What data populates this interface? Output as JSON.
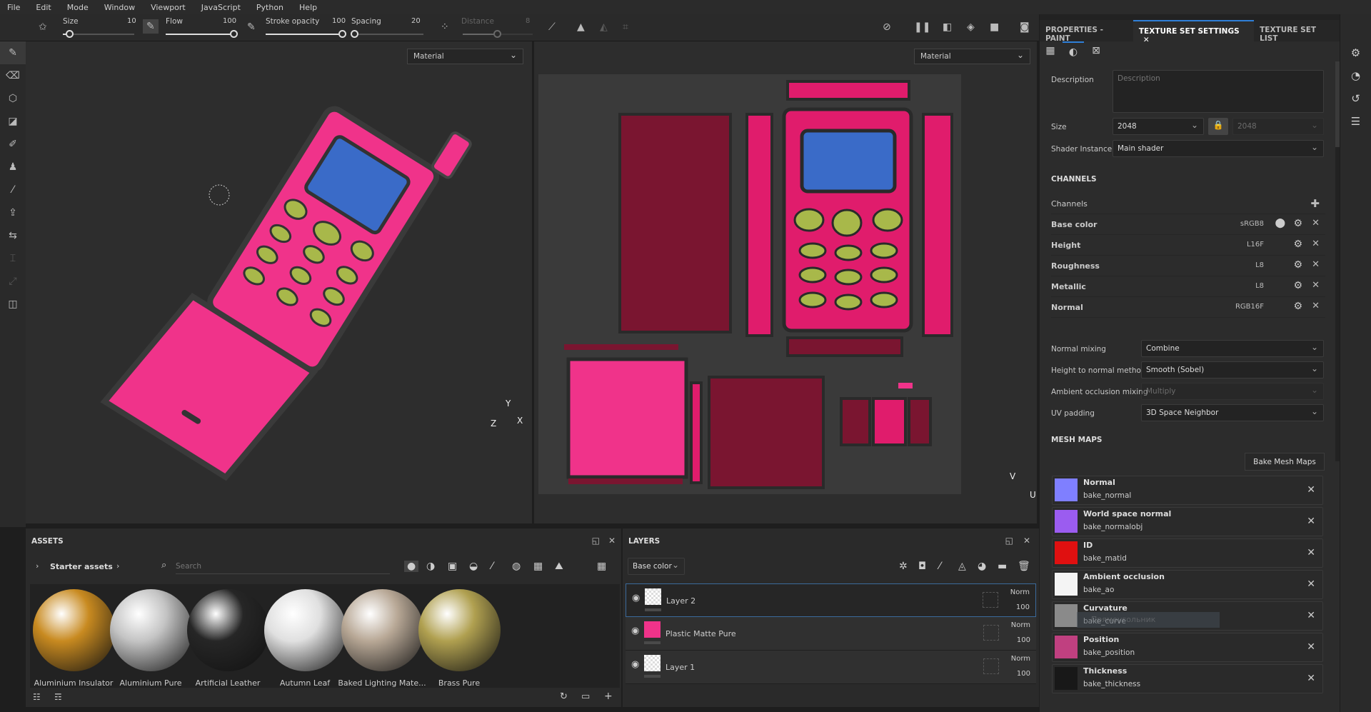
{
  "menu": [
    "File",
    "Edit",
    "Mode",
    "Window",
    "Viewport",
    "JavaScript",
    "Python",
    "Help"
  ],
  "toolbar": {
    "size": {
      "label": "Size",
      "value": "10",
      "fraction": 0.1
    },
    "flow": {
      "label": "Flow",
      "value": "100",
      "fraction": 1.0
    },
    "stroke_opacity": {
      "label": "Stroke opacity",
      "value": "100",
      "fraction": 1.0
    },
    "spacing": {
      "label": "Spacing",
      "value": "20",
      "fraction": 0.02
    },
    "distance": {
      "label": "Distance",
      "value": "8",
      "fraction": 0.5
    }
  },
  "viewport3d": {
    "mode": "Material",
    "axis": [
      "Y",
      "Z",
      "X"
    ]
  },
  "viewport2d": {
    "mode": "Material",
    "axis": [
      "V",
      "U"
    ]
  },
  "right_panel": {
    "tabs": [
      "PROPERTIES - PAINT",
      "TEXTURE SET SETTINGS",
      "TEXTURE SET LIST"
    ],
    "description_label": "Description",
    "description_placeholder": "Description",
    "size_label": "Size",
    "size_value": "2048",
    "size_value2": "2048",
    "shader_label": "Shader Instance",
    "shader_value": "Main shader",
    "channels_heading": "CHANNELS",
    "channels_label": "Channels",
    "channels": [
      {
        "name": "Base color",
        "format": "sRGB8"
      },
      {
        "name": "Height",
        "format": "L16F"
      },
      {
        "name": "Roughness",
        "format": "L8"
      },
      {
        "name": "Metallic",
        "format": "L8"
      },
      {
        "name": "Normal",
        "format": "RGB16F"
      }
    ],
    "settings": [
      {
        "label": "Normal mixing",
        "value": "Combine",
        "disabled": false
      },
      {
        "label": "Height to normal method",
        "value": "Smooth (Sobel)",
        "disabled": false
      },
      {
        "label": "Ambient occlusion mixing",
        "value": "Multiply",
        "disabled": true
      },
      {
        "label": "UV padding",
        "value": "3D Space Neighbor",
        "disabled": false
      }
    ],
    "mesh_maps_heading": "MESH MAPS",
    "bake_button": "Bake Mesh Maps",
    "mesh_maps": [
      {
        "title": "Normal",
        "file": "bake_normal",
        "color": "#7f7fff"
      },
      {
        "title": "World space normal",
        "file": "bake_normalobj",
        "color": "#9b5cf0"
      },
      {
        "title": "ID",
        "file": "bake_matid",
        "color": "#e01010"
      },
      {
        "title": "Ambient occlusion",
        "file": "bake_ao",
        "color": "#f4f4f4"
      },
      {
        "title": "Curvature",
        "file": "bake_curve",
        "color": "#8a8a8a"
      },
      {
        "title": "Position",
        "file": "bake_position",
        "color": "#c04080"
      },
      {
        "title": "Thickness",
        "file": "bake_thickness",
        "color": "#181818"
      }
    ],
    "tooltip": "Прямоугольник"
  },
  "assets": {
    "title": "ASSETS",
    "breadcrumb": "Starter assets",
    "search_placeholder": "Search",
    "items": [
      {
        "name": "Aluminium Insulator",
        "color": "#c88a20"
      },
      {
        "name": "Aluminium Pure",
        "color": "#c4c4c4"
      },
      {
        "name": "Artificial Leather",
        "color": "#262626"
      },
      {
        "name": "Autumn Leaf",
        "color": "#e0e0e0"
      },
      {
        "name": "Baked Lighting Mate...",
        "color": "#b8a896"
      },
      {
        "name": "Brass Pure",
        "color": "#b0a050"
      }
    ]
  },
  "layers": {
    "title": "LAYERS",
    "channel": "Base color",
    "items": [
      {
        "name": "Layer 2",
        "blend": "Norm",
        "opacity": "100",
        "selected": true
      },
      {
        "name": "Plastic Matte Pure",
        "blend": "Norm",
        "opacity": "100",
        "selected": false
      },
      {
        "name": "Layer 1",
        "blend": "Norm",
        "opacity": "100",
        "selected": false
      }
    ]
  },
  "colors": {
    "accent": "#2f7fd8",
    "pink": "#f0338a",
    "screen": "#3a6bc8",
    "button": "#a8b84a",
    "maroon": "#7a1530"
  }
}
